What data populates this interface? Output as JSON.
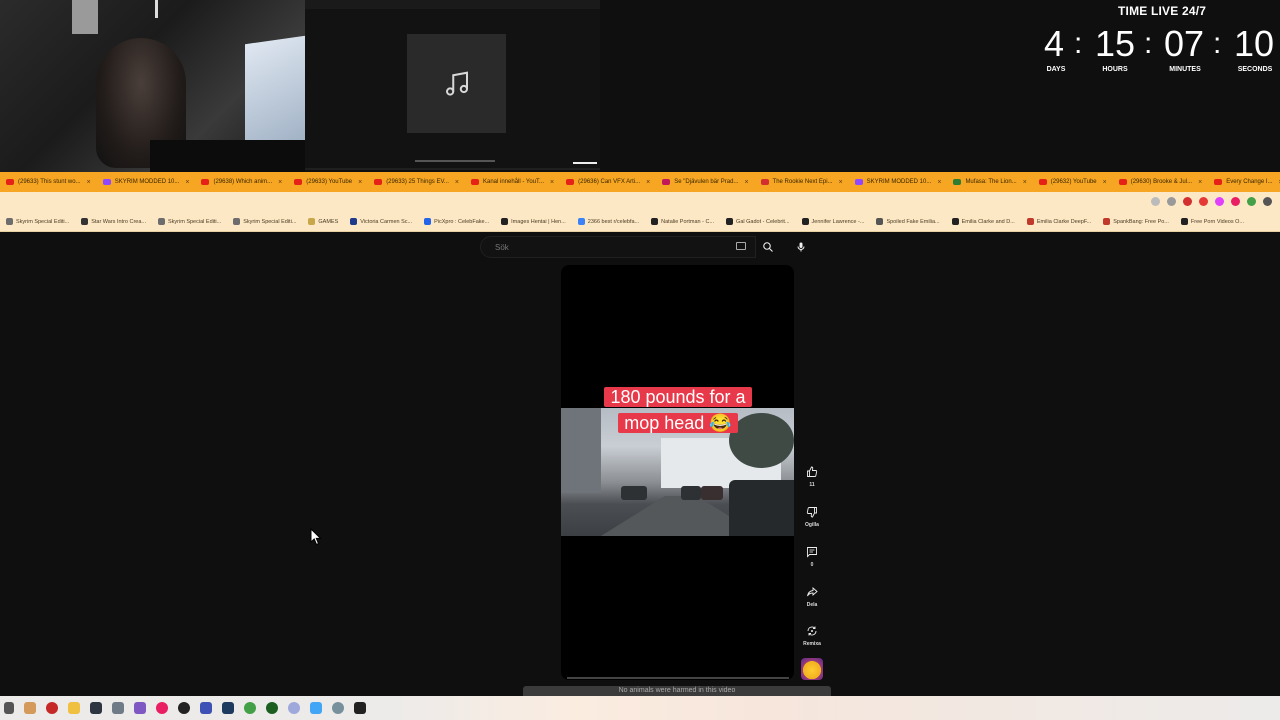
{
  "overlay": {
    "timer": {
      "title": "TIME LIVE 24/7",
      "days": "4",
      "hours": "15",
      "minutes": "07",
      "seconds": "10",
      "days_label": "DAYS",
      "hours_label": "HOURS",
      "minutes_label": "MINUTES",
      "seconds_label": "SECONDS",
      "separator": ":"
    },
    "mini_player_icon": "music-note-icon"
  },
  "browser": {
    "accent_color": "#f6a623",
    "tabs": [
      {
        "label": "(29633) This stunt wo...",
        "icon_color": "#e62117"
      },
      {
        "label": "SKYRIM MODDED 10...",
        "icon_color": "#9146ff"
      },
      {
        "label": "(29638) Which anim...",
        "icon_color": "#e62117"
      },
      {
        "label": "(29633) YouTube",
        "icon_color": "#e62117"
      },
      {
        "label": "(29633) 25 Things EV...",
        "icon_color": "#e62117"
      },
      {
        "label": "Kanal innehåll - YouT...",
        "icon_color": "#e62117"
      },
      {
        "label": "(29636) Can VFX Arti...",
        "icon_color": "#e62117"
      },
      {
        "label": "Se \"Djävulen bär Prad...",
        "icon_color": "#c2185b"
      },
      {
        "label": "The Rookie Next Epi...",
        "icon_color": "#d32f2f"
      },
      {
        "label": "SKYRIM MODDED 10...",
        "icon_color": "#9146ff"
      },
      {
        "label": "Mufasa: The Lion...",
        "icon_color": "#2e7d32"
      },
      {
        "label": "(29632) YouTube",
        "icon_color": "#e62117"
      },
      {
        "label": "(29630) Brooke & Jul...",
        "icon_color": "#e62117"
      },
      {
        "label": "Every Change I...",
        "icon_color": "#e62117"
      }
    ],
    "bookmarks": [
      {
        "label": "Skyrim Special Editi...",
        "icon_color": "#6d6d6d"
      },
      {
        "label": "Star Wars Intro Crea...",
        "icon_color": "#333333"
      },
      {
        "label": "Skyrim Special Editi...",
        "icon_color": "#6d6d6d"
      },
      {
        "label": "Skyrim Special Editi...",
        "icon_color": "#6d6d6d"
      },
      {
        "label": "GAMES",
        "icon_color": "#c8a64a"
      },
      {
        "label": "Victoria Carmen Sc...",
        "icon_color": "#1e3a8a"
      },
      {
        "label": "PicXpro : CelebFake...",
        "icon_color": "#2563eb"
      },
      {
        "label": "Images Hentai | Hen...",
        "icon_color": "#222222"
      },
      {
        "label": "2366 best r/celebfa...",
        "icon_color": "#3b82f6"
      },
      {
        "label": "Natalie Portman - C...",
        "icon_color": "#222222"
      },
      {
        "label": "Gal Gadot - Celebrit...",
        "icon_color": "#222222"
      },
      {
        "label": "Jennifer Lawrence -...",
        "icon_color": "#222222"
      },
      {
        "label": "Spoiled Fake Emilia...",
        "icon_color": "#555555"
      },
      {
        "label": "Emilia Clarke and D...",
        "icon_color": "#222222"
      },
      {
        "label": "Emilia Clarke DeepF...",
        "icon_color": "#c0392b"
      },
      {
        "label": "SpankBang: Free Po...",
        "icon_color": "#c0392b"
      },
      {
        "label": "Free Porn Videos O...",
        "icon_color": "#222222"
      }
    ]
  },
  "youtube": {
    "search_placeholder": "Sök",
    "caption_line1": "180 pounds for a",
    "caption_line2": "mop head 😂",
    "actions": {
      "like_count": "11",
      "dislike_label": "Ogilla",
      "comment_count": "0",
      "share_label": "Dela",
      "remix_label": "Remixa"
    },
    "disclaimer": "No animals were harmed in this video"
  }
}
